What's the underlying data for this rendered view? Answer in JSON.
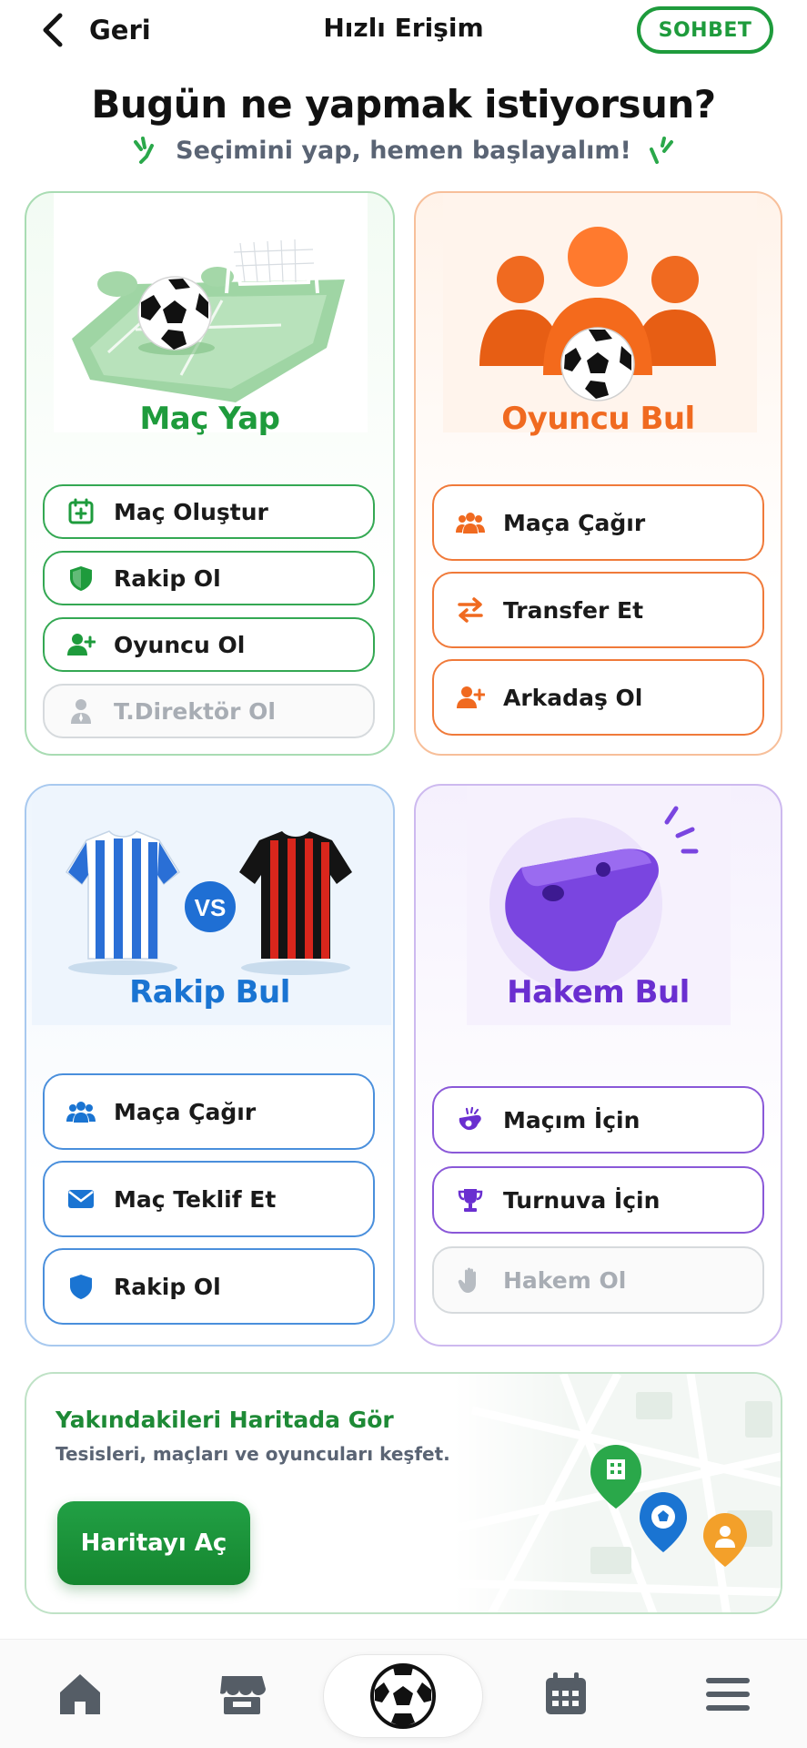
{
  "header": {
    "back_label": "Geri",
    "title": "Hızlı Erişim",
    "chat_label": "SOHBET"
  },
  "hero": {
    "title": "Bugün ne yapmak istiyorsun?",
    "subtitle": "Seçimini yap, hemen başlayalım!"
  },
  "colors": {
    "green": "#1e9b3c",
    "orange": "#f06a20",
    "blue": "#1a74d2",
    "purple": "#6a2fd0"
  },
  "cards": {
    "match": {
      "title": "Maç Yap",
      "options": [
        {
          "label": "Maç Oluştur",
          "icon": "calendar-plus-icon"
        },
        {
          "label": "Rakip Ol",
          "icon": "shield-icon"
        },
        {
          "label": "Oyuncu Ol",
          "icon": "user-plus-icon"
        },
        {
          "label": "T.Direktör Ol",
          "icon": "manager-icon",
          "disabled": true
        }
      ]
    },
    "player": {
      "title": "Oyuncu Bul",
      "options": [
        {
          "label": "Maça Çağır",
          "icon": "users-icon"
        },
        {
          "label": "Transfer Et",
          "icon": "transfer-arrows-icon"
        },
        {
          "label": "Arkadaş Ol",
          "icon": "user-plus-icon"
        }
      ]
    },
    "rival": {
      "title": "Rakip Bul",
      "vs_label": "VS",
      "options": [
        {
          "label": "Maça Çağır",
          "icon": "users-icon"
        },
        {
          "label": "Maç Teklif Et",
          "icon": "envelope-icon"
        },
        {
          "label": "Rakip Ol",
          "icon": "shield-icon"
        }
      ]
    },
    "referee": {
      "title": "Hakem Bul",
      "options": [
        {
          "label": "Maçım İçin",
          "icon": "whistle-icon"
        },
        {
          "label": "Turnuva İçin",
          "icon": "trophy-icon"
        },
        {
          "label": "Hakem Ol",
          "icon": "hand-icon",
          "disabled": true
        }
      ]
    }
  },
  "map_card": {
    "title": "Yakındakileri Haritada Gör",
    "subtitle": "Tesisleri, maçları ve oyuncuları keşfet.",
    "button_label": "Haritayı Aç"
  },
  "bottom_nav": {
    "items": [
      "home-icon",
      "store-icon",
      "soccer-ball-icon",
      "calendar-icon",
      "menu-icon"
    ]
  }
}
